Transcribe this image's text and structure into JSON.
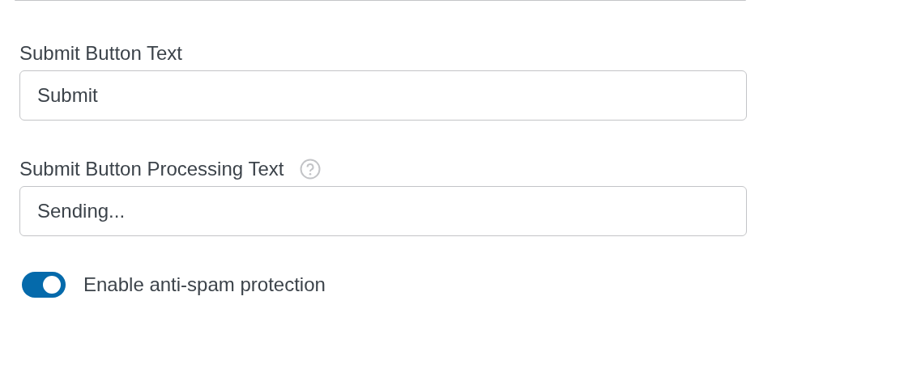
{
  "fields": [
    {
      "label": "Submit Button Text",
      "value": "Submit",
      "help": false
    },
    {
      "label": "Submit Button Processing Text",
      "value": "Sending...",
      "help": true
    }
  ],
  "toggle": {
    "label": "Enable anti-spam protection",
    "on": true
  }
}
